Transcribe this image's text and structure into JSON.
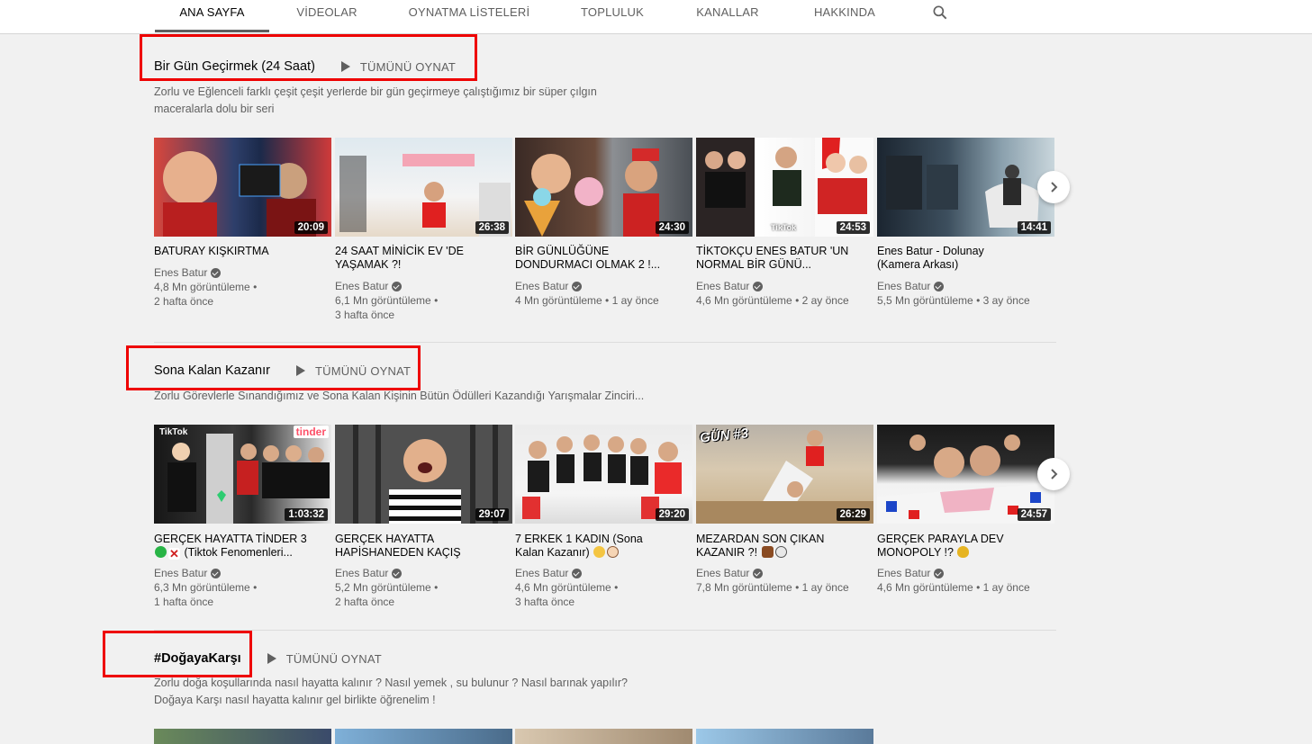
{
  "tabs": [
    {
      "label": "ANA SAYFA",
      "active": true
    },
    {
      "label": "VİDEOLAR"
    },
    {
      "label": "OYNATMA LİSTELERİ"
    },
    {
      "label": "TOPLULUK"
    },
    {
      "label": "KANALLAR"
    },
    {
      "label": "HAKKINDA"
    }
  ],
  "shelves": [
    {
      "title": "Bir Gün Geçirmek (24 Saat)",
      "play_all": "TÜMÜNÜ OYNAT",
      "description_lines": [
        "Zorlu ve Eğlenceli farklı çeşit çeşit yerlerde bir gün geçirmeye çalıştığımız bir süper çılgın",
        "maceralarla dolu bir seri"
      ],
      "videos": [
        {
          "title": "BATURAY KIŞKIRTMA",
          "channel": "Enes Batur",
          "views": "4,8 Mn görüntüleme •",
          "age": "2 hafta önce",
          "duration": "20:09"
        },
        {
          "title": "24 SAAT MİNİCİK EV 'DE YAŞAMAK ?!",
          "channel": "Enes Batur",
          "views": "6,1 Mn görüntüleme •",
          "age": "3 hafta önce",
          "duration": "26:38"
        },
        {
          "title": "BİR GÜNLÜĞÜNE DONDURMACI OLMAK 2 !...",
          "channel": "Enes Batur",
          "views": "4 Mn görüntüleme • 1 ay önce",
          "age": "",
          "duration": "24:30"
        },
        {
          "title": "TİKTOKÇU ENES BATUR 'UN NORMAL BİR GÜNÜ...",
          "channel": "Enes Batur",
          "views": "4,6 Mn görüntüleme • 2 ay önce",
          "age": "",
          "duration": "24:53"
        },
        {
          "title": "Enes Batur - Dolunay (Kamera Arkası)",
          "channel": "Enes Batur",
          "views": "5,5 Mn görüntüleme • 3 ay önce",
          "age": "",
          "duration": "14:41"
        }
      ]
    },
    {
      "title": "Sona Kalan Kazanır",
      "play_all": "TÜMÜNÜ OYNAT",
      "description_lines": [
        "Zorlu Görevlerle Sınandığımız ve Sona Kalan Kişinin Bütün Ödülleri Kazandığı Yarışmalar Zinciri..."
      ],
      "videos": [
        {
          "title": "GERÇEK HAYATTA TİNDER 3",
          "title2": "(Tiktok Fenomenleri...",
          "channel": "Enes Batur",
          "views": "6,3 Mn görüntüleme •",
          "age": "1 hafta önce",
          "duration": "1:03:32"
        },
        {
          "title": "GERÇEK HAYATTA HAPİSHANEDEN KAÇIŞ",
          "channel": "Enes Batur",
          "views": "5,2 Mn görüntüleme •",
          "age": "2 hafta önce",
          "duration": "29:07"
        },
        {
          "title": "7 ERKEK 1 KADIN (Sona Kalan Kazanır)",
          "channel": "Enes Batur",
          "views": "4,6 Mn görüntüleme •",
          "age": "3 hafta önce",
          "duration": "29:20"
        },
        {
          "title": "MEZARDAN SON ÇIKAN KAZANIR ?!",
          "channel": "Enes Batur",
          "views": "7,8 Mn görüntüleme • 1 ay önce",
          "age": "",
          "duration": "26:29"
        },
        {
          "title": "GERÇEK PARAYLA DEV MONOPOLY !?",
          "channel": "Enes Batur",
          "views": "4,6 Mn görüntüleme • 1 ay önce",
          "age": "",
          "duration": "24:57"
        }
      ]
    },
    {
      "title": "#DoğayaKarşı",
      "play_all": "TÜMÜNÜ OYNAT",
      "description_lines": [
        "Zorlu doğa koşullarında nasıl hayatta kalınır ? Nasıl yemek , su bulunur ? Nasıl barınak yapılır?",
        "Doğaya Karşı nasıl hayatta kalınır gel birlikte öğrenelim !"
      ]
    }
  ],
  "thumb_labels": {
    "tiktok": "TikTok",
    "tinder": "tinder",
    "gun": "GÜN #3"
  },
  "colors": {
    "highlight": "#e00000",
    "accent_red": "#d92b2b"
  }
}
